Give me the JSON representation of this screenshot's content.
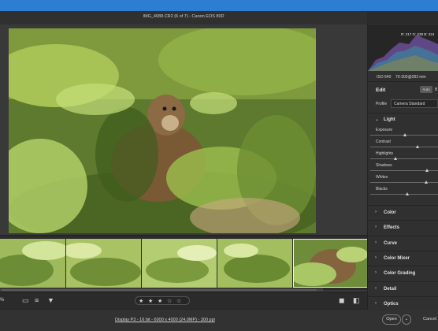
{
  "window": {
    "title": "IMG_4088.CR2 (6 of 7)  -  Canon EOS 80D"
  },
  "histogram": {
    "readout": "R: 217   G: 239   B: 224"
  },
  "camera_info": {
    "iso": "ISO 640",
    "lens": "70-300@283 mm"
  },
  "edit_panel": {
    "header": "Edit",
    "auto_label": "Auto",
    "bw_label": "B",
    "profile_label": "Profile",
    "profile_value": "Camera Standard",
    "light_section": "Light",
    "sliders": [
      {
        "label": "Exposure",
        "value": 0.52
      },
      {
        "label": "Contrast",
        "value": 0.7
      },
      {
        "label": "Highlights",
        "value": 0.38
      },
      {
        "label": "Shadows",
        "value": 0.84
      },
      {
        "label": "Whites",
        "value": 0.83
      },
      {
        "label": "Blacks",
        "value": 0.55
      }
    ],
    "sections": [
      "Color",
      "Effects",
      "Curve",
      "Color Mixer",
      "Color Grading",
      "Detail",
      "Optics"
    ]
  },
  "bottom_bar": {
    "zoom": "%",
    "rating": [
      "★",
      "★",
      "★",
      "☆",
      "☆"
    ]
  },
  "status_bar": {
    "workflow_options": "Display P3 - 16 bit - 6000 x 4000 (24.0MP) - 300 ppi",
    "open_label": "Open",
    "cancel_label": "Cancel"
  },
  "colors": {
    "accent_blue": "#2d7ed3",
    "panel_bg": "#303030",
    "app_bg": "#3a3a3a"
  }
}
